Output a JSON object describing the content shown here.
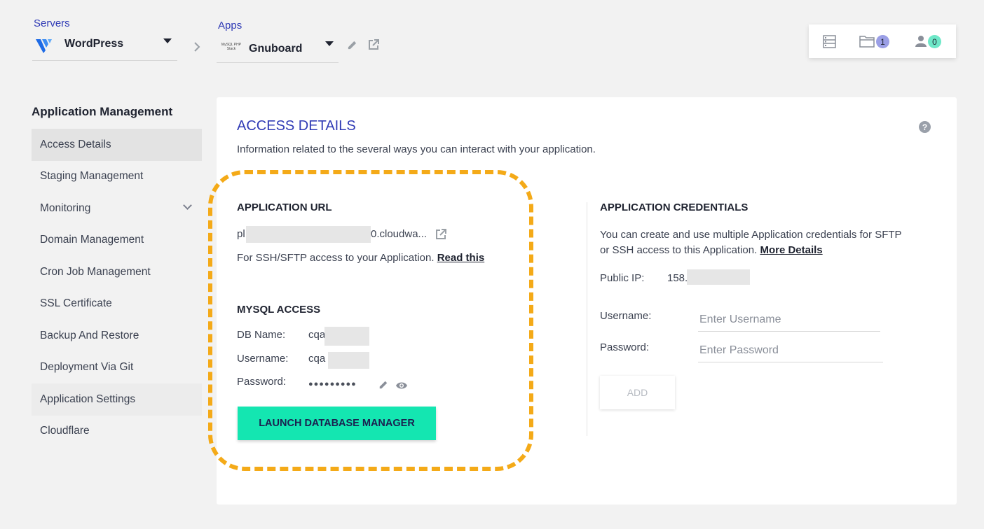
{
  "header": {
    "servers_label": "Servers",
    "server_name": "WordPress",
    "apps_label": "Apps",
    "app_name": "Gnuboard",
    "app_logo_text": "MySQL PHP Stack",
    "folder_count": "1",
    "user_count": "0"
  },
  "sidebar": {
    "title": "Application Management",
    "items": [
      {
        "label": "Access Details"
      },
      {
        "label": "Staging Management"
      },
      {
        "label": "Monitoring"
      },
      {
        "label": "Domain Management"
      },
      {
        "label": "Cron Job Management"
      },
      {
        "label": "SSL Certificate"
      },
      {
        "label": "Backup And Restore"
      },
      {
        "label": "Deployment Via Git"
      },
      {
        "label": "Application Settings"
      },
      {
        "label": "Cloudflare"
      }
    ]
  },
  "panel": {
    "title": "ACCESS DETAILS",
    "description": "Information related to the several ways you can interact with your application."
  },
  "app_url": {
    "title": "APPLICATION URL",
    "url_start": "pl",
    "url_end": "0.cloudwa...",
    "ssh_text": "For SSH/SFTP access to your Application.",
    "ssh_link": "Read this"
  },
  "mysql": {
    "title": "MYSQL ACCESS",
    "db_name_label": "DB Name:",
    "db_name_value": "cqa",
    "username_label": "Username:",
    "username_value": "cqa",
    "password_label": "Password:",
    "password_value": "●●●●●●●●●",
    "launch_button": "LAUNCH DATABASE MANAGER"
  },
  "credentials": {
    "title": "APPLICATION CREDENTIALS",
    "desc_line1": "You can create and use multiple Application credentials for SFTP",
    "desc_line2": "or SSH access to this Application.",
    "more_link": "More Details",
    "public_ip_label": "Public IP:",
    "public_ip_value": "158.",
    "username_label": "Username:",
    "username_placeholder": "Enter Username",
    "password_label": "Password:",
    "password_placeholder": "Enter Password",
    "add_button": "ADD"
  },
  "colors": {
    "accent": "#2f3ab5",
    "launch": "#14e6b1",
    "highlight": "#f4aa18",
    "badge_folder": "#9b9fe6",
    "badge_user": "#6ee8c8"
  }
}
